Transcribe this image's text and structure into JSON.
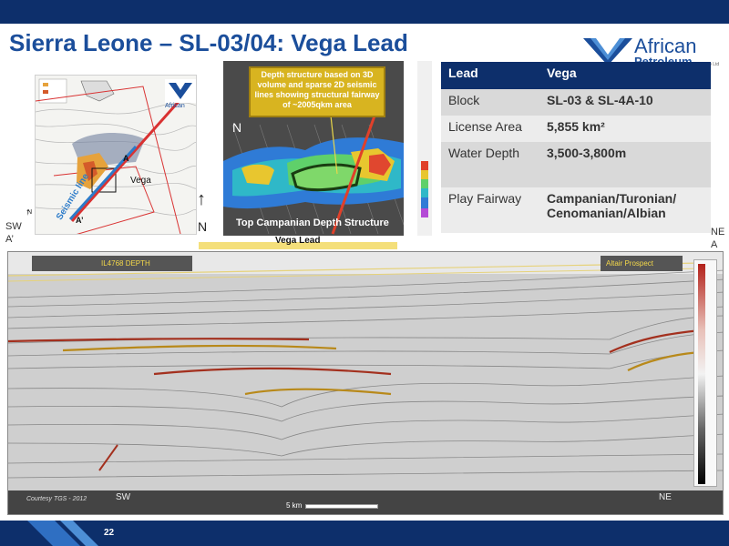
{
  "slide": {
    "title": "Sierra Leone – SL-03/04: Vega Lead",
    "page_number": "22"
  },
  "logo": {
    "line1": "African",
    "line2": "Petroleum",
    "ltd": "Corp Ltd"
  },
  "location_map": {
    "label_a": "A",
    "label_a_prime": "A’",
    "label_vega": "Vega",
    "seismic_line": "Seismic line",
    "north": "N",
    "logo_text": "African"
  },
  "depth_map": {
    "callout": "Depth structure based on 3D volume and sparse 2D seismic lines showing structural fairway of ~2005qkm area",
    "caption": "Top Campanian Depth Structure",
    "north": "N"
  },
  "vega_lead_bar": "Vega Lead",
  "table": {
    "header": [
      "Lead",
      "Vega"
    ],
    "rows": [
      {
        "label": "Block",
        "value": "SL-03 & SL-4A-10"
      },
      {
        "label": "License Area",
        "value": "5,855 km²"
      },
      {
        "label": "Water Depth",
        "value": "3,500-3,800m"
      },
      {
        "label": "Play Fairway",
        "value": "Campanian/Turonian/ Cenomanian/Albian"
      }
    ]
  },
  "section": {
    "sw_top": "SW",
    "sw_bottom": "A’",
    "ne_top": "NE",
    "ne_bottom": "A",
    "tag_left": "IL4768 DEPTH",
    "tag_right": "Altair Prospect",
    "courtesy": "Courtesy TGS - 2012",
    "foot_sw": "SW",
    "foot_ne": "NE",
    "scale": "5 km"
  },
  "colors": {
    "brand_navy": "#0d2f6b",
    "title_blue": "#1b4e9b",
    "callout_yellow": "#d8b420"
  }
}
